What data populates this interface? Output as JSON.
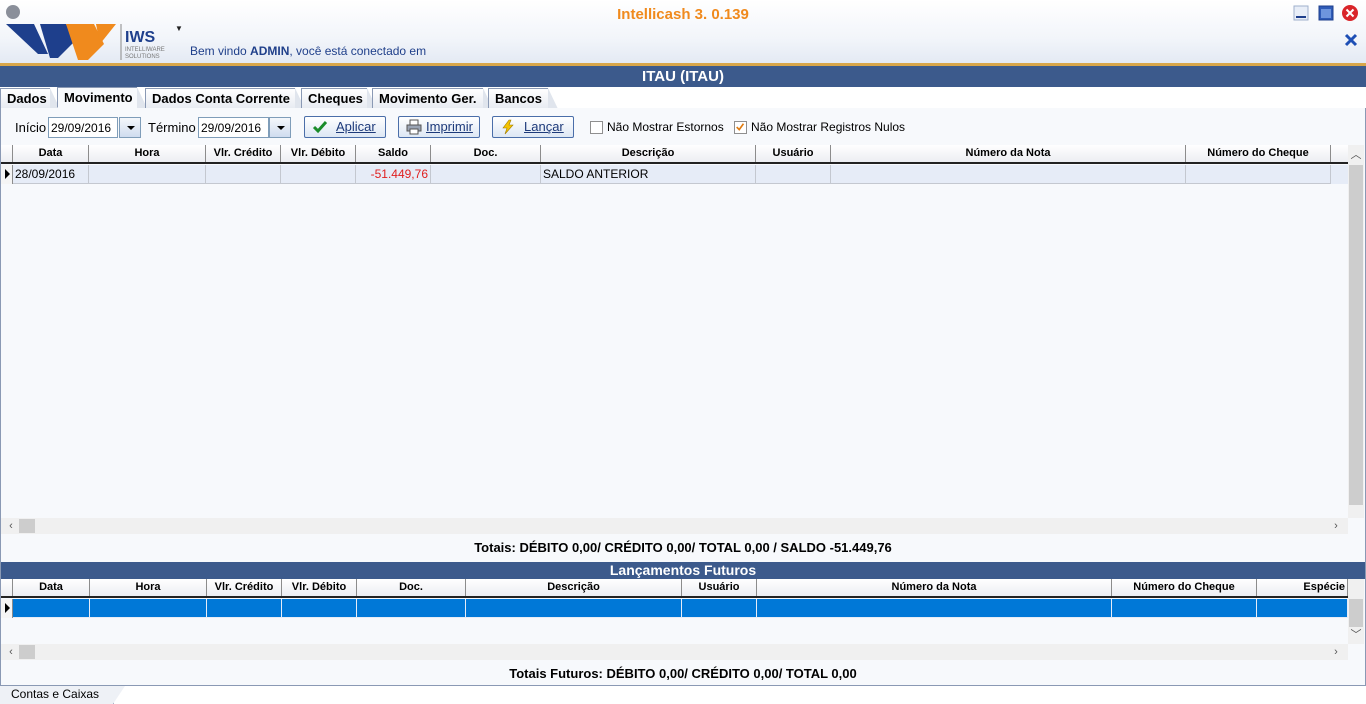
{
  "app": {
    "title": "Intellicash 3. 0.139",
    "logo_text": "IWS",
    "logo_subtitle_1": "INTELLIWARE",
    "logo_subtitle_2": "SOLUTIONS",
    "welcome_prefix": "Bem vindo ",
    "welcome_user": "ADMIN",
    "welcome_suffix": ", você está conectado em"
  },
  "form": {
    "title": "ITAU (ITAU)"
  },
  "tabs": [
    {
      "label": "Dados"
    },
    {
      "label": "Movimento",
      "active": true
    },
    {
      "label": "Dados Conta Corrente"
    },
    {
      "label": "Cheques"
    },
    {
      "label": "Movimento Ger."
    },
    {
      "label": "Bancos"
    }
  ],
  "filters": {
    "inicio_label": "Início",
    "inicio_value": "29/09/2016",
    "termino_label": "Término",
    "termino_value": "29/09/2016",
    "aplicar_label": "Aplicar",
    "imprimir_label": "Imprimir",
    "lancar_label": "Lançar",
    "nao_mostrar_estornos_label": "Não Mostrar Estornos",
    "nao_mostrar_estornos_checked": false,
    "nao_mostrar_nulos_label": "Não Mostrar Registros Nulos",
    "nao_mostrar_nulos_checked": true
  },
  "movimento_grid": {
    "columns": [
      "Data",
      "Hora",
      "Vlr. Crédito",
      "Vlr. Débito",
      "Saldo",
      "Doc.",
      "Descrição",
      "Usuário",
      "Número da Nota",
      "Número do Cheque"
    ],
    "rows": [
      {
        "data": "28/09/2016",
        "hora": "",
        "credito": "",
        "debito": "",
        "saldo": "-51.449,76",
        "doc": "",
        "descricao": "SALDO ANTERIOR",
        "usuario": "",
        "nota": "",
        "cheque": ""
      }
    ],
    "negative_color": "#e02020"
  },
  "totals": {
    "text": "Totais: DÉBITO 0,00/ CRÉDITO  0,00/ TOTAL  0,00 / SALDO -51.449,76"
  },
  "futuros": {
    "title": "Lançamentos Futuros",
    "columns": [
      "Data",
      "Hora",
      "Vlr. Crédito",
      "Vlr. Débito",
      "Doc.",
      "Descrição",
      "Usuário",
      "Número da Nota",
      "Número do Cheque",
      "Espécie"
    ],
    "selected_row_color": "#0078d7",
    "totals_text": "Totais Futuros: DÉBITO 0,00/ CRÉDITO  0,00/ TOTAL  0,00"
  },
  "bottom_tabs": [
    {
      "label": "Contas e Caixas"
    }
  ],
  "icons": {
    "minimize": "minimize-icon",
    "maximize": "maximize-icon",
    "close": "close-icon",
    "aplicar": "checkmark-icon",
    "imprimir": "printer-icon",
    "lancar": "lightning-icon"
  }
}
